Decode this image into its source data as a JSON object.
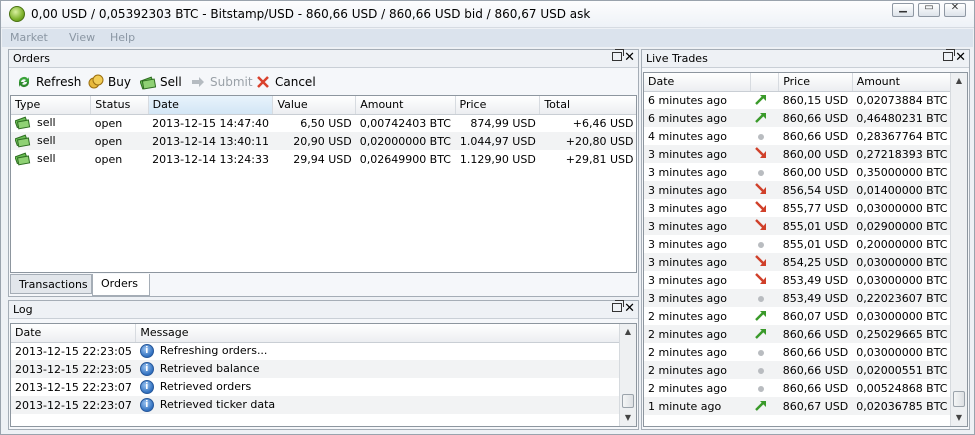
{
  "window": {
    "title": "0,00 USD / 0,05392303 BTC - Bitstamp/USD - 860,66 USD / 860,66 USD bid / 860,67 USD ask"
  },
  "menu": [
    "Market",
    "View",
    "Help"
  ],
  "orders_panel": {
    "title": "Orders",
    "toolbar": {
      "refresh": "Refresh",
      "buy": "Buy",
      "sell": "Sell",
      "submit": "Submit",
      "cancel": "Cancel"
    },
    "columns": [
      "Type",
      "Status",
      "Date",
      "Value",
      "Amount",
      "Price",
      "Total"
    ],
    "rows": [
      {
        "type": "sell",
        "status": "open",
        "date": "2013-12-15 14:47:40",
        "value": "6,50 USD",
        "amount": "0,00742403 BTC",
        "price": "874,99 USD",
        "total": "+6,46 USD"
      },
      {
        "type": "sell",
        "status": "open",
        "date": "2013-12-14 13:40:11",
        "value": "20,90 USD",
        "amount": "0,02000000 BTC",
        "price": "1.044,97 USD",
        "total": "+20,80 USD"
      },
      {
        "type": "sell",
        "status": "open",
        "date": "2013-12-14 13:24:33",
        "value": "29,94 USD",
        "amount": "0,02649900 BTC",
        "price": "1.129,90 USD",
        "total": "+29,81 USD"
      }
    ],
    "tabs": [
      "Transactions",
      "Orders"
    ]
  },
  "log_panel": {
    "title": "Log",
    "columns": [
      "Date",
      "Message"
    ],
    "rows": [
      {
        "date": "2013-12-15 22:23:05",
        "message": "Refreshing orders..."
      },
      {
        "date": "2013-12-15 22:23:05",
        "message": "Retrieved balance"
      },
      {
        "date": "2013-12-15 22:23:07",
        "message": "Retrieved orders"
      },
      {
        "date": "2013-12-15 22:23:07",
        "message": "Retrieved ticker data"
      }
    ]
  },
  "trades_panel": {
    "title": "Live Trades",
    "columns": [
      "Date",
      "Price",
      "Amount"
    ],
    "rows": [
      {
        "date": "6 minutes ago",
        "trend": "up",
        "price": "860,15 USD",
        "amount": "0,02073884 BTC"
      },
      {
        "date": "6 minutes ago",
        "trend": "up",
        "price": "860,66 USD",
        "amount": "0,46480231 BTC"
      },
      {
        "date": "4 minutes ago",
        "trend": "flat",
        "price": "860,66 USD",
        "amount": "0,28367764 BTC"
      },
      {
        "date": "3 minutes ago",
        "trend": "down",
        "price": "860,00 USD",
        "amount": "0,27218393 BTC"
      },
      {
        "date": "3 minutes ago",
        "trend": "flat",
        "price": "860,00 USD",
        "amount": "0,35000000 BTC"
      },
      {
        "date": "3 minutes ago",
        "trend": "down",
        "price": "856,54 USD",
        "amount": "0,01400000 BTC"
      },
      {
        "date": "3 minutes ago",
        "trend": "down",
        "price": "855,77 USD",
        "amount": "0,03000000 BTC"
      },
      {
        "date": "3 minutes ago",
        "trend": "down",
        "price": "855,01 USD",
        "amount": "0,02900000 BTC"
      },
      {
        "date": "3 minutes ago",
        "trend": "flat",
        "price": "855,01 USD",
        "amount": "0,20000000 BTC"
      },
      {
        "date": "3 minutes ago",
        "trend": "down",
        "price": "854,25 USD",
        "amount": "0,03000000 BTC"
      },
      {
        "date": "3 minutes ago",
        "trend": "down",
        "price": "853,49 USD",
        "amount": "0,03000000 BTC"
      },
      {
        "date": "3 minutes ago",
        "trend": "flat",
        "price": "853,49 USD",
        "amount": "0,22023607 BTC"
      },
      {
        "date": "2 minutes ago",
        "trend": "up",
        "price": "860,07 USD",
        "amount": "0,03000000 BTC"
      },
      {
        "date": "2 minutes ago",
        "trend": "up",
        "price": "860,66 USD",
        "amount": "0,25029665 BTC"
      },
      {
        "date": "2 minutes ago",
        "trend": "flat",
        "price": "860,66 USD",
        "amount": "0,03000000 BTC"
      },
      {
        "date": "2 minutes ago",
        "trend": "flat",
        "price": "860,66 USD",
        "amount": "0,02000551 BTC"
      },
      {
        "date": "2 minutes ago",
        "trend": "flat",
        "price": "860,66 USD",
        "amount": "0,00524868 BTC"
      },
      {
        "date": "1 minute ago",
        "trend": "up",
        "price": "860,67 USD",
        "amount": "0,02036785 BTC"
      }
    ]
  },
  "colors": {
    "trend_up": "#3a9a2a",
    "trend_down": "#d0402a",
    "trend_flat": "#b9bcc0"
  }
}
